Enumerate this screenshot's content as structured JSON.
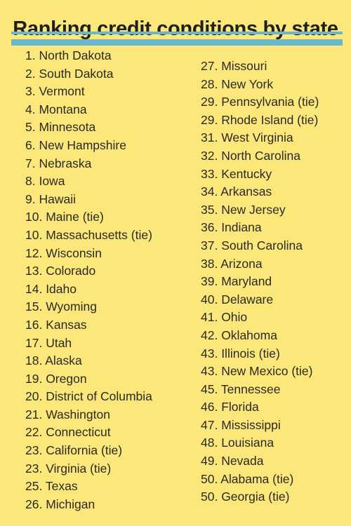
{
  "title": "Ranking credit conditions by state",
  "colors": {
    "background": "#FCE77A",
    "accent_bar": "#6BB7C9",
    "text": "#2a2a22"
  },
  "rankings_left": [
    "1. North Dakota",
    "2. South Dakota",
    "3. Vermont",
    "4. Montana",
    "5. Minnesota",
    "6. New Hampshire",
    "7. Nebraska",
    "8. Iowa",
    "9. Hawaii",
    "10. Maine (tie)",
    "10. Massachusetts (tie)",
    "12. Wisconsin",
    "13. Colorado",
    "14. Idaho",
    "15. Wyoming",
    "16. Kansas",
    "17. Utah",
    "18. Alaska",
    "19. Oregon",
    "20. District of Columbia",
    "21. Washington",
    "22. Connecticut",
    "23. California (tie)",
    "23. Virginia (tie)",
    "25. Texas",
    "26. Michigan"
  ],
  "rankings_right": [
    "27. Missouri",
    "28. New York",
    "29. Pennsylvania (tie)",
    "29. Rhode Island (tie)",
    "31. West Virginia",
    "32. North Carolina",
    "33. Kentucky",
    "34. Arkansas",
    "35. New Jersey",
    "36. Indiana",
    "37. South Carolina",
    "38. Arizona",
    "39. Maryland",
    "40. Delaware",
    "41. Ohio",
    "42. Oklahoma",
    "43. Illinois (tie)",
    "43. New Mexico (tie)",
    "45. Tennessee",
    "46. Florida",
    "47. Mississippi",
    "48. Louisiana",
    "49. Nevada",
    "50. Alabama (tie)",
    "50. Georgia (tie)"
  ]
}
